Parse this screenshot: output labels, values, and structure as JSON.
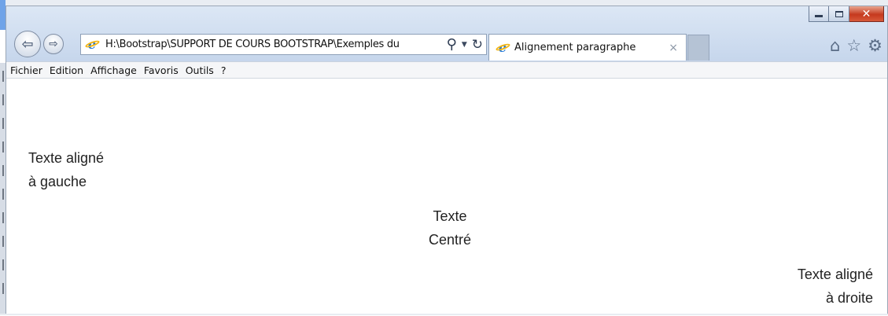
{
  "browser": {
    "address": "H:\\Bootstrap\\SUPPORT DE COURS BOOTSTRAP\\Exemples du",
    "tab_title": "Alignement paragraphe",
    "tab_close": "×",
    "icons": {
      "back": "back-arrow-icon",
      "forward": "forward-arrow-icon",
      "search": "search-icon",
      "refresh": "refresh-icon",
      "home": "home-icon",
      "favorites": "star-icon",
      "settings": "gear-icon",
      "minimize": "minimize-icon",
      "maximize": "maximize-icon",
      "close": "close-icon"
    },
    "colors": {
      "chrome_top": "#dce7f5",
      "chrome_bottom": "#c6d6ec",
      "close_button": "#c5391e",
      "ie_blue": "#1a73d6",
      "ie_ring": "#f2b514"
    }
  },
  "menu": {
    "items": [
      "Fichier",
      "Edition",
      "Affichage",
      "Favoris",
      "Outils",
      "?"
    ]
  },
  "page": {
    "left": {
      "line1": "Texte aligné",
      "line2": "à gauche"
    },
    "center": {
      "line1": "Texte",
      "line2": "Centré"
    },
    "right": {
      "line1": "Texte aligné",
      "line2": "à droite"
    }
  }
}
